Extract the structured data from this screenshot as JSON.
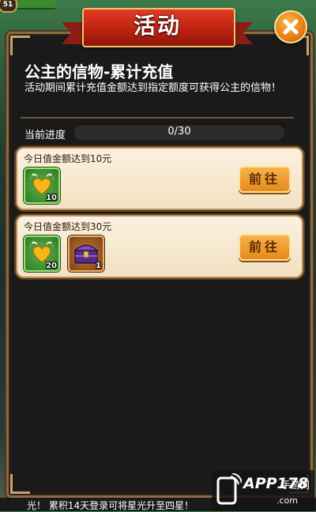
{
  "player": {
    "level": "51"
  },
  "header": {
    "title": "活动"
  },
  "activity": {
    "name": "公主的信物-累计充值",
    "description": "活动期间累计充值金额达到指定额度可获得公主的信物！"
  },
  "progress": {
    "label": "当前进度",
    "value": "0/30",
    "fraction": 0
  },
  "tasks": [
    {
      "title": "今日值金额达到10元",
      "button": "前往",
      "rewards": [
        {
          "icon": "gold-heart-icon",
          "count": "10"
        }
      ]
    },
    {
      "title": "今日值金额达到30元",
      "button": "前往",
      "rewards": [
        {
          "icon": "gold-heart-icon",
          "count": "20"
        },
        {
          "icon": "purple-chest-icon",
          "count": "1"
        }
      ]
    }
  ],
  "ticker": {
    "text": "光！ 累积14天登录可将星光升至四星！"
  },
  "watermark": {
    "brand": "APP178",
    "sub": "手游网",
    "domain": ".com"
  },
  "colors": {
    "ribbon": "#c3220f",
    "accent": "#e68a1a",
    "panel": "#1a1a1a"
  }
}
